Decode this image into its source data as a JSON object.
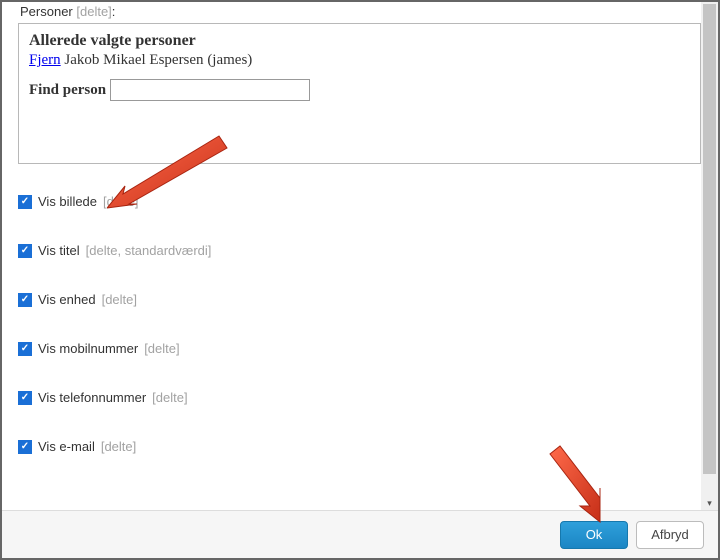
{
  "personsSection": {
    "label": "Personer",
    "labelSuffix": "[delte]",
    "boxHeading": "Allerede valgte personer",
    "removeLabel": "Fjern",
    "personName": "Jakob Mikael Espersen",
    "personUser": "(james)",
    "findLabel": "Find person",
    "findValue": ""
  },
  "checkboxes": [
    {
      "label": "Vis billede",
      "suffix": "[delte]"
    },
    {
      "label": "Vis titel",
      "suffix": "[delte, standardværdi]"
    },
    {
      "label": "Vis enhed",
      "suffix": "[delte]"
    },
    {
      "label": "Vis mobilnummer",
      "suffix": "[delte]"
    },
    {
      "label": "Vis telefonnummer",
      "suffix": "[delte]"
    },
    {
      "label": "Vis e-mail",
      "suffix": "[delte]"
    }
  ],
  "footer": {
    "ok": "Ok",
    "cancel": "Afbryd"
  }
}
